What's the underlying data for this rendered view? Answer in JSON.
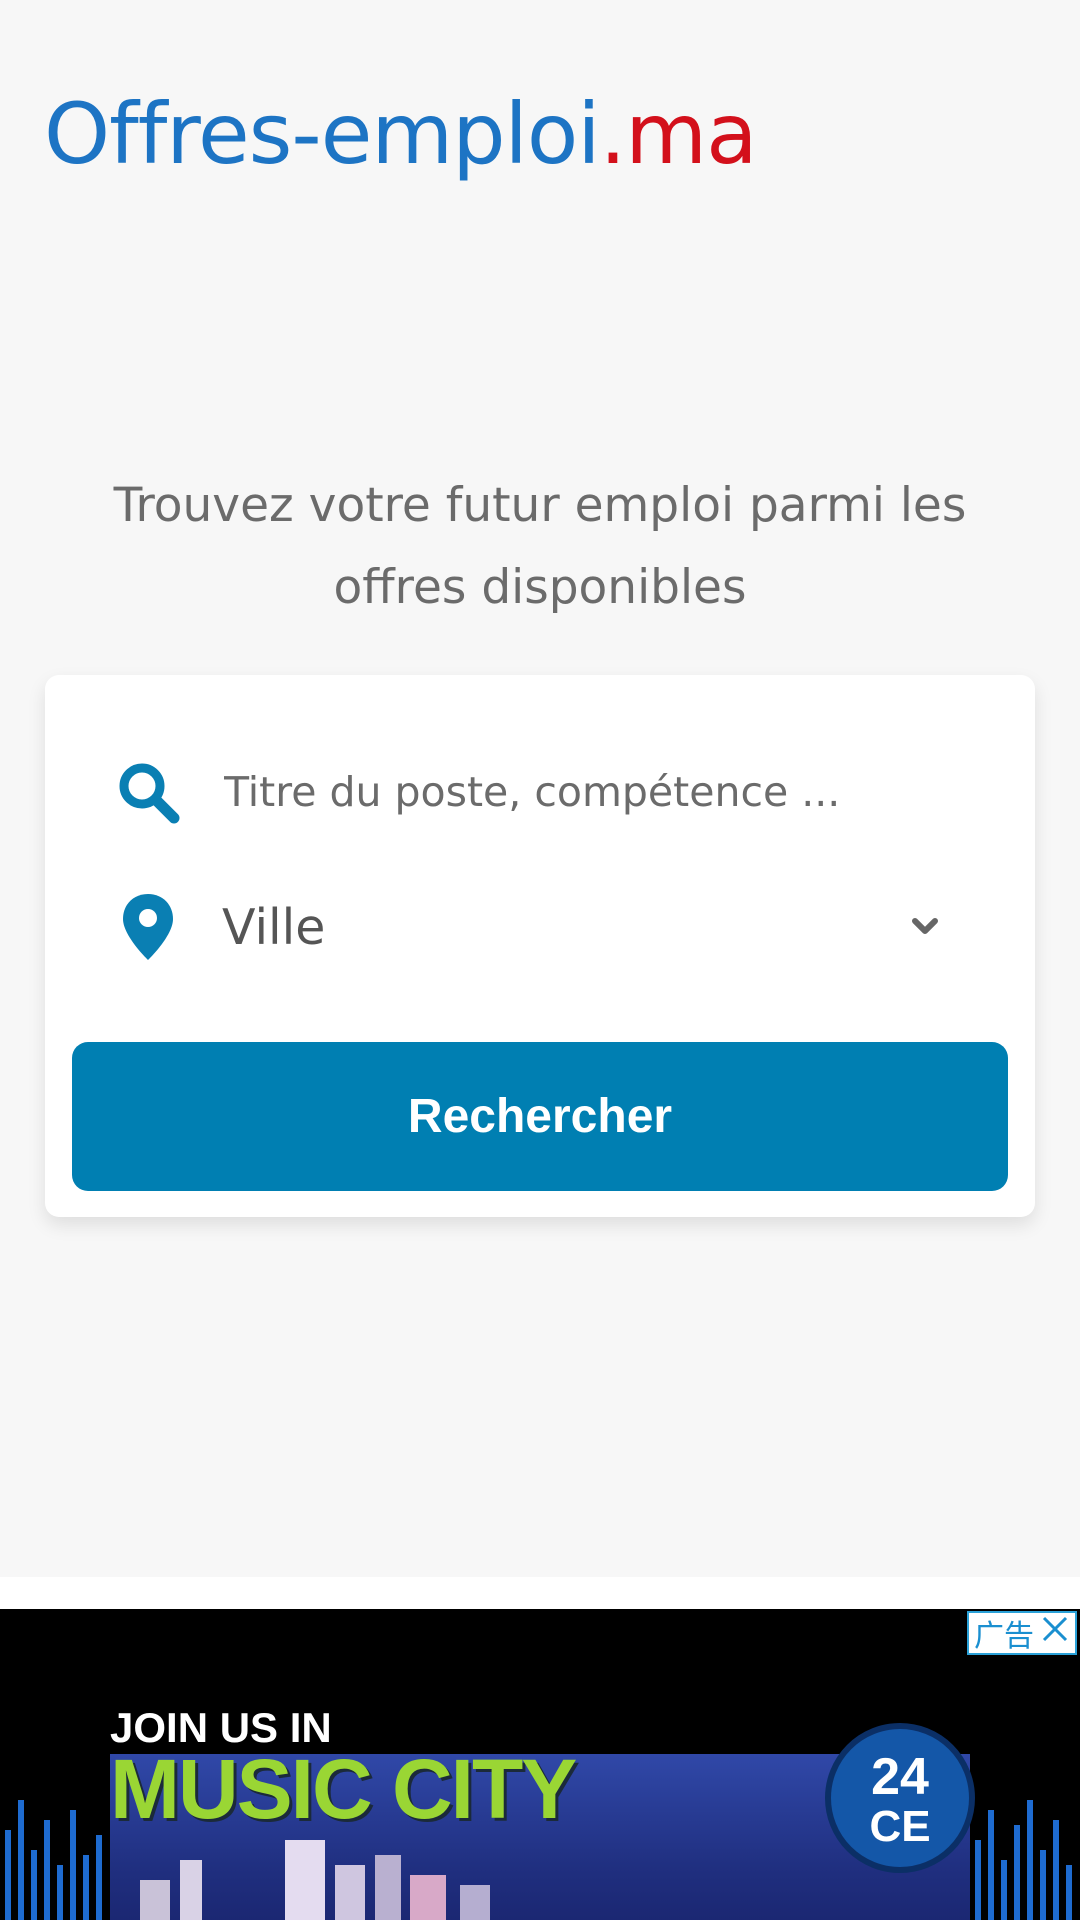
{
  "logo": {
    "main": "Offres-emploi",
    "suffix": ".ma"
  },
  "tagline": "Trouvez votre futur emploi parmi les offres disponibles",
  "search": {
    "placeholder": "Titre du poste, compétence ...",
    "city_value": "Ville",
    "button_label": "Rechercher"
  },
  "ad": {
    "label": "广告",
    "headline_small": "JOIN US IN",
    "headline_big": "MUSIC CITY",
    "badge_number": "24",
    "badge_text": "CE"
  },
  "colors": {
    "brand_blue": "#1d74c4",
    "brand_red": "#d3101b",
    "button": "#007fb2"
  }
}
